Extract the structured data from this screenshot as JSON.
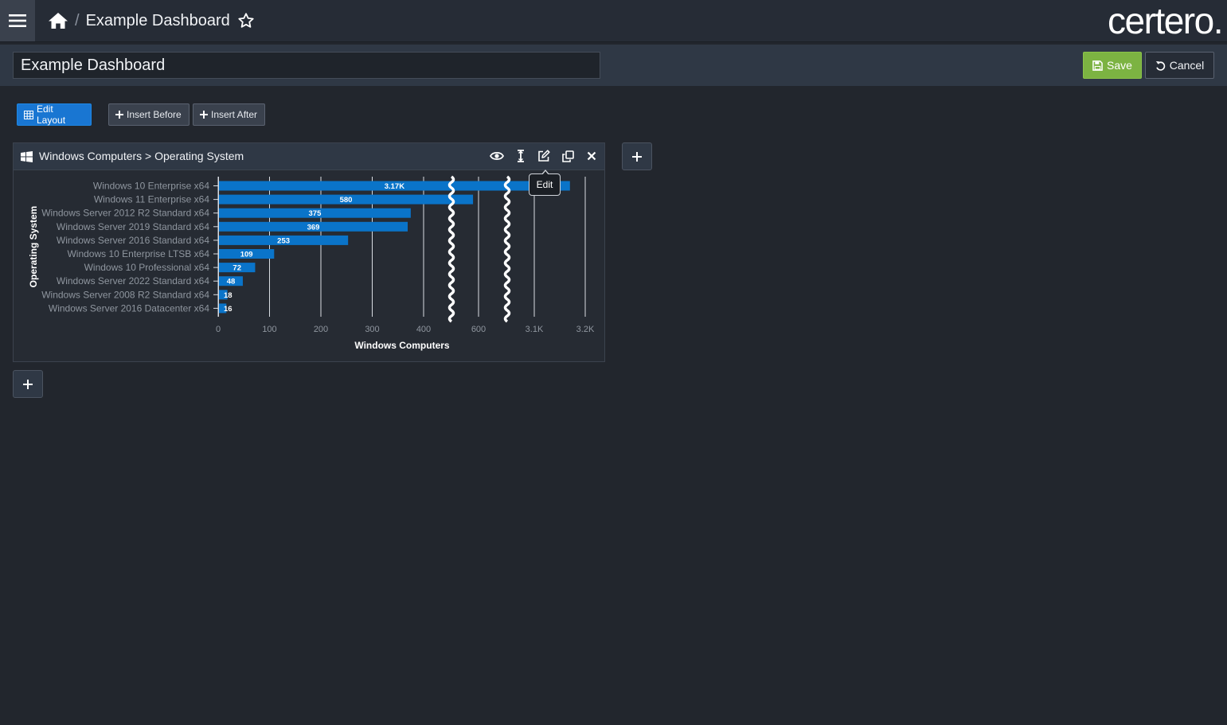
{
  "header": {
    "breadcrumb_title": "Example Dashboard",
    "separator": "/",
    "logo_text": "certero.",
    "icons": {
      "menu": "hamburger-icon",
      "home": "home-icon",
      "favorite": "star-outline-icon"
    }
  },
  "titlebar": {
    "dashboard_name_value": "Example Dashboard",
    "save_label": "Save",
    "cancel_label": "Cancel",
    "colors": {
      "save": "#7cb342"
    }
  },
  "toolbar": {
    "edit_layout_label": "Edit Layout",
    "insert_before_label": "Insert Before",
    "insert_after_label": "Insert After",
    "colors": {
      "edit_layout": "#1976d2"
    }
  },
  "widget": {
    "title": "Windows Computers > Operating System",
    "tools": [
      "eye-icon",
      "resize-icon",
      "edit-icon",
      "clone-icon",
      "close-icon"
    ],
    "tooltip": "Edit"
  },
  "chart_data": {
    "type": "bar",
    "orientation": "horizontal",
    "axis_break": true,
    "categories": [
      "Windows 10 Enterprise x64",
      "Windows 11 Enterprise x64",
      "Windows Server 2012 R2 Standard x64",
      "Windows Server 2019 Standard x64",
      "Windows Server 2016 Standard x64",
      "Windows 10 Enterprise LTSB x64",
      "Windows 10 Professional x64",
      "Windows Server 2022 Standard x64",
      "Windows Server 2008 R2 Standard x64",
      "Windows Server 2016 Datacenter x64"
    ],
    "values": [
      3170,
      580,
      375,
      369,
      253,
      109,
      72,
      48,
      18,
      16
    ],
    "value_labels": [
      "3.17K",
      "580",
      "375",
      "369",
      "253",
      "109",
      "72",
      "48",
      "18",
      "16"
    ],
    "x_ticks": [
      "0",
      "100",
      "200",
      "300",
      "400",
      "600",
      "3.1K",
      "3.2K"
    ],
    "xlabel": "Windows Computers",
    "ylabel": "Operating System",
    "grid": true,
    "bar_color": "#0a74c9"
  }
}
